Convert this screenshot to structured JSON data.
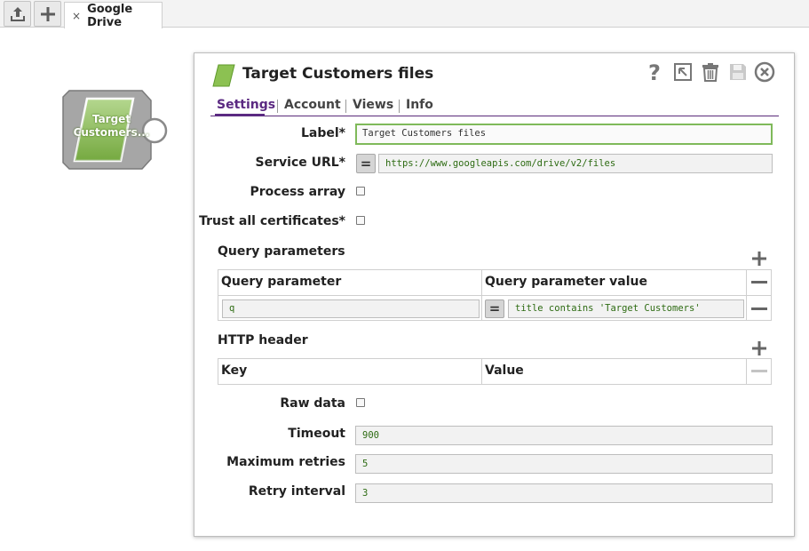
{
  "toolbar": {
    "upload_icon": "upload-icon",
    "add_icon": "plus-icon"
  },
  "tab": {
    "close_glyph": "×",
    "label": "Google Drive"
  },
  "snap": {
    "label": "Target Customers..."
  },
  "dialog": {
    "title": "Target Customers files",
    "header_icons": [
      "help-icon",
      "export-icon",
      "trash-icon",
      "save-icon",
      "close-icon"
    ],
    "tabs": [
      "Settings",
      "Account",
      "Views",
      "Info"
    ],
    "active_tab": "Settings",
    "fields": {
      "label": {
        "label": "Label*",
        "value": "Target Customers files"
      },
      "service_url": {
        "label": "Service URL*",
        "value": "https://www.googleapis.com/drive/v2/files",
        "expr_glyph": "="
      },
      "process_array": {
        "label": "Process array",
        "checked": false
      },
      "trust_all": {
        "label": "Trust all certificates*",
        "checked": false
      }
    },
    "query_parameters": {
      "title": "Query parameters",
      "columns": [
        "Query parameter",
        "Query parameter value"
      ],
      "rows": [
        {
          "param": "q",
          "value": "title contains 'Target Customers'",
          "expr_glyph": "="
        }
      ]
    },
    "http_header": {
      "title": "HTTP header",
      "columns": [
        "Key",
        "Value"
      ],
      "rows": []
    },
    "raw_data": {
      "label": "Raw data",
      "checked": false
    },
    "timeout": {
      "label": "Timeout",
      "value": "900"
    },
    "max_retries": {
      "label": "Maximum retries",
      "value": "5"
    },
    "retry_interval": {
      "label": "Retry interval",
      "value": "3"
    }
  },
  "colors": {
    "accent": "#5b2a82",
    "snap_green": "#8cc152",
    "value_text": "#2d6b12"
  }
}
